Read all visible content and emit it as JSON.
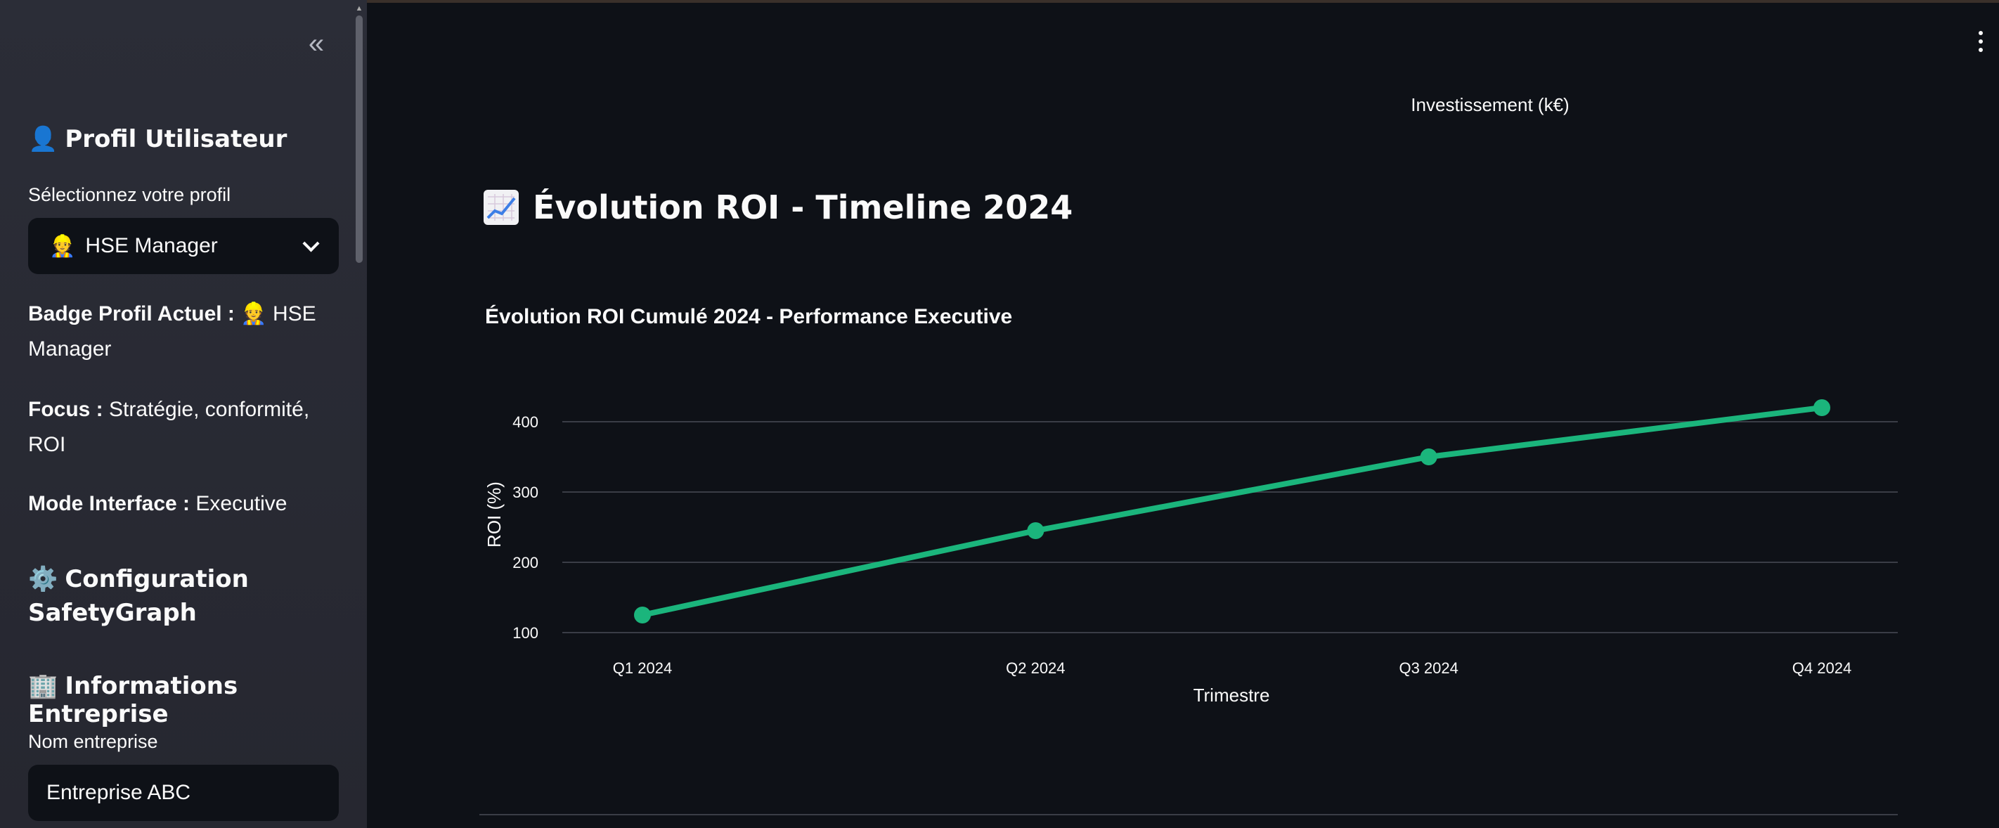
{
  "sidebar": {
    "collapse_glyph": "«",
    "profile_heading": "Profil Utilisateur",
    "profile_icon": "👤",
    "select_label": "Sélectionnez votre profil",
    "selected_profile_icon": "👷",
    "selected_profile": "HSE Manager",
    "badge_label": "Badge Profil Actuel :",
    "badge_value": "👷 HSE Manager",
    "focus_label": "Focus :",
    "focus_value": "Stratégie, conformité, ROI",
    "mode_label": "Mode Interface :",
    "mode_value": "Executive",
    "config_icon": "⚙️",
    "config_heading": "Configuration SafetyGraph",
    "company_icon": "🏢",
    "company_heading": "Informations Entreprise",
    "company_name_label": "Nom entreprise",
    "company_name_value": "Entreprise ABC"
  },
  "main": {
    "top_label": "Investissement (k€)",
    "title": "Évolution ROI - Timeline 2024",
    "title_icon": "chart-increasing-icon"
  },
  "chart_data": {
    "type": "line",
    "title": "Évolution ROI Cumulé 2024 - Performance Executive",
    "xlabel": "Trimestre",
    "ylabel": "ROI (%)",
    "categories": [
      "Q1 2024",
      "Q2 2024",
      "Q3 2024",
      "Q4 2024"
    ],
    "series": [
      {
        "values": [
          125,
          245,
          350,
          420
        ]
      }
    ],
    "yticks": [
      100,
      200,
      300,
      400
    ],
    "ylim": [
      80,
      440
    ],
    "grid": true,
    "color": "#1bb57c"
  },
  "colors": {
    "background": "#0e1117",
    "sidebar": "#262730",
    "accent": "#1bb57c",
    "grid": "#3a3d46"
  }
}
